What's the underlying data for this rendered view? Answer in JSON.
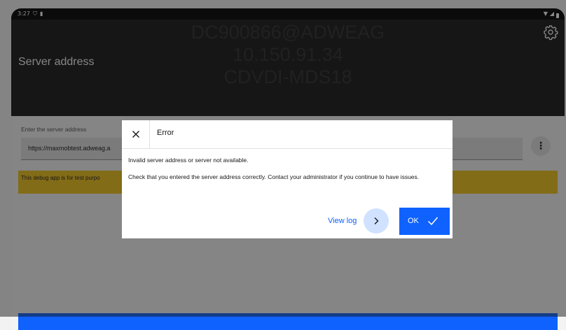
{
  "status_bar": {
    "time": "3:27",
    "left_icons": [
      "shield-icon",
      "sim-icon"
    ],
    "right_icons": [
      "wifi-icon",
      "signal-icon",
      "battery-icon"
    ]
  },
  "header": {
    "title": "Server address",
    "overlay_lines": [
      "DC900866@ADWEAG",
      "10.150.91.34",
      "CDVDI-MDS18"
    ],
    "settings_icon": "gear-icon"
  },
  "form": {
    "field_label": "Enter the server address",
    "field_value": "https://maxmobtest.adweag.a",
    "more_icon": "overflow-menu-icon"
  },
  "banner": {
    "text": "This debug app is for test purpo"
  },
  "dialog": {
    "title": "Error",
    "message_primary": "Invalid server address or server not available.",
    "message_secondary": "Check that you entered the server address correctly. Contact your administrator if you continue to have issues.",
    "view_log_label": "View log",
    "ok_label": "OK"
  },
  "colors": {
    "header_bg": "#161616",
    "primary": "#0f62fe",
    "warning": "#f1c21b",
    "dialog_bg": "#ffffff"
  }
}
